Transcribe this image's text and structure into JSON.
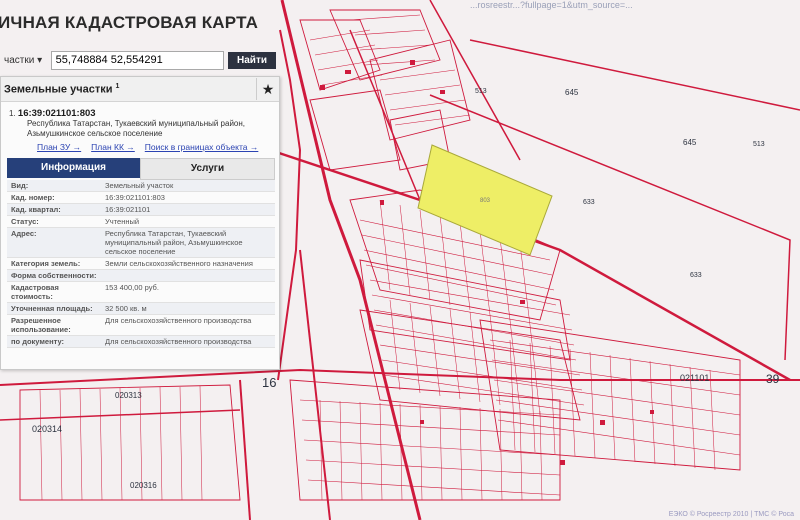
{
  "header": {
    "title": "ИЧНАЯ КАДАСТРОВАЯ КАРТА",
    "url": "...rosreestr...?fullpage=1&utm_source=..."
  },
  "search": {
    "scope": "частки ▾",
    "value": "55,748884 52,554291",
    "button": "Найти"
  },
  "panel": {
    "heading": "Земельные участки",
    "heading_count": "1",
    "record": {
      "index": "1.",
      "cad_number": "16:39:021101:803",
      "address": "Республика Татарстан, Тукаевский муниципальный район, Азьмушкинское сельское поселение",
      "links": [
        "План ЗУ →",
        "План КК →",
        "Поиск в границах объекта →"
      ]
    },
    "tabs": [
      "Информация",
      "Услуги"
    ],
    "rows": [
      {
        "k": "Вид:",
        "v": "Земельный участок"
      },
      {
        "k": "Кад. номер:",
        "v": "16:39:021101:803"
      },
      {
        "k": "Кад. квартал:",
        "v": "16:39:021101"
      },
      {
        "k": "Статус:",
        "v": "Учтенный"
      },
      {
        "k": "Адрес:",
        "v": "Республика Татарстан, Тукаевский муниципальный район, Азьмушкинское сельское поселение"
      },
      {
        "k": "Категория земель:",
        "v": "Земли сельскохозяйственного назначения"
      },
      {
        "k": "Форма собственности:",
        "v": ""
      },
      {
        "k": "Кадастровая стоимость:",
        "v": "153 400,00 руб."
      },
      {
        "k": "Уточненная площадь:",
        "v": "32 500 кв. м"
      },
      {
        "k": "Разрешенное использование:",
        "v": "Для сельскохозяйственного производства"
      },
      {
        "k": "по документу:",
        "v": "Для сельскохозяйственного производства"
      }
    ]
  },
  "map": {
    "labels": {
      "q1": "645",
      "q2": "645",
      "q3": "513",
      "q4": "513",
      "q5": "633",
      "q6": "633",
      "b1": "021101",
      "b2": "39",
      "b3": "16",
      "b4": "020314",
      "b5": "020316",
      "b6": "020313",
      "sel": "803"
    },
    "colors": {
      "boundary": "#cf1a3d",
      "selected": "#eeee66",
      "bg": "#f4f0f1"
    }
  },
  "footer": "ЕЭКО © Росреестр 2010 | ТМС © Роса"
}
